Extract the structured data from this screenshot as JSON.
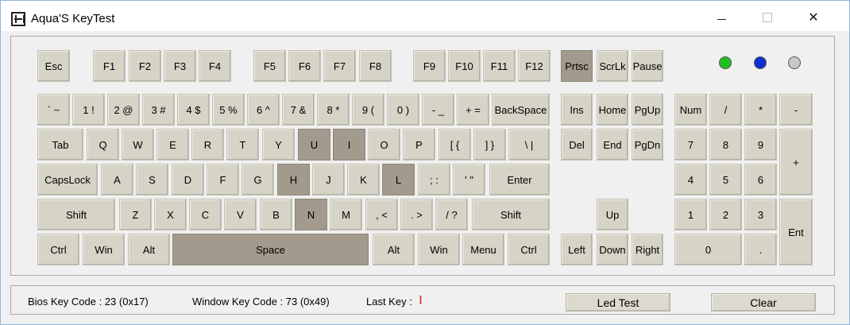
{
  "window": {
    "title": "Aqua'S KeyTest"
  },
  "leds": {
    "num": "#20c020",
    "caps": "#1030d0",
    "scroll": "#c8c8c8"
  },
  "keys": {
    "esc": "Esc",
    "f1": "F1",
    "f2": "F2",
    "f3": "F3",
    "f4": "F4",
    "f5": "F5",
    "f6": "F6",
    "f7": "F7",
    "f8": "F8",
    "f9": "F9",
    "f10": "F10",
    "f11": "F11",
    "f12": "F12",
    "prtsc": "Prtsc",
    "scrlk": "ScrLk",
    "pause": "Pause",
    "backtick": "` ~",
    "d1": "1 !",
    "d2": "2 @",
    "d3": "3 #",
    "d4": "4 $",
    "d5": "5 %",
    "d6": "6 ^",
    "d7": "7 &",
    "d8": "8 *",
    "d9": "9 (",
    "d0": "0 )",
    "minus": "- _",
    "equal": "+ =",
    "backspace": "BackSpace",
    "ins": "Ins",
    "home": "Home",
    "pgup": "PgUp",
    "num": "Num",
    "kp_div": "/",
    "kp_mul": "*",
    "kp_sub": "-",
    "tab": "Tab",
    "q": "Q",
    "w": "W",
    "e": "E",
    "r": "R",
    "t": "T",
    "y": "Y",
    "u": "U",
    "i": "I",
    "o": "O",
    "p": "P",
    "lbracket": "[ {",
    "rbracket": "] }",
    "backslash": "\\ |",
    "del": "Del",
    "end": "End",
    "pgdn": "PgDn",
    "kp7": "7",
    "kp8": "8",
    "kp9": "9",
    "kp_add": "+",
    "capslock": "CapsLock",
    "a": "A",
    "s": "S",
    "d": "D",
    "f": "F",
    "g": "G",
    "h": "H",
    "j": "J",
    "k": "K",
    "l": "L",
    "semicolon": "; :",
    "quote": "' \"",
    "enter": "Enter",
    "kp4": "4",
    "kp5": "5",
    "kp6": "6",
    "lshift": "Shift",
    "z": "Z",
    "x": "X",
    "c": "C",
    "v": "V",
    "b": "B",
    "n": "N",
    "m": "M",
    "comma": ", <",
    "period": ". >",
    "slash": "/ ?",
    "rshift": "Shift",
    "up": "Up",
    "kp1": "1",
    "kp2": "2",
    "kp3": "3",
    "kp_enter": "Ent",
    "lctrl": "Ctrl",
    "lwin": "Win",
    "lalt": "Alt",
    "space": "Space",
    "ralt": "Alt",
    "rwin": "Win",
    "menu": "Menu",
    "rctrl": "Ctrl",
    "left": "Left",
    "down": "Down",
    "right": "Right",
    "kp0": "0",
    "kp_dot": "."
  },
  "status": {
    "bios_key_code": "Bios Key Code : 23 (0x17)",
    "window_key_code": "Window Key Code : 73 (0x49)",
    "last_key_label": "Last Key :",
    "last_key_value": "I",
    "led_test": "Led Test",
    "clear": "Clear"
  }
}
